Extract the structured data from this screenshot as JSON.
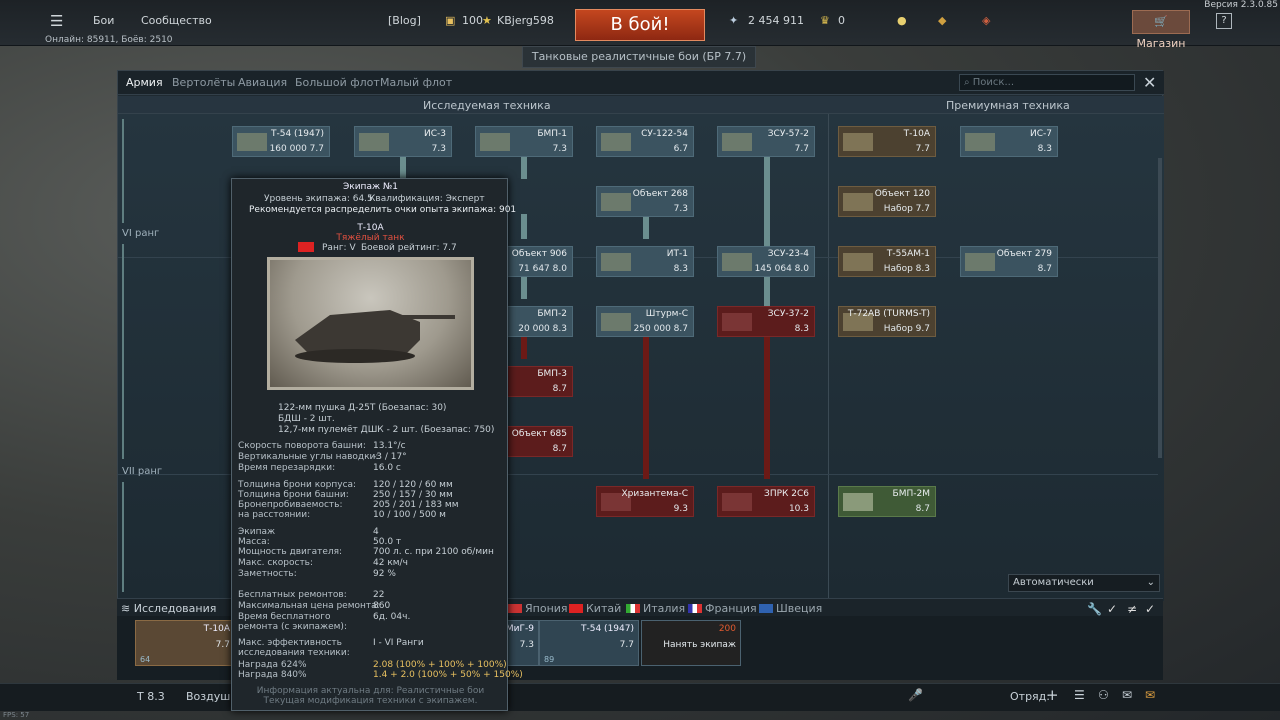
{
  "app": {
    "version": "Версия 2.3.0.85",
    "fps": "FPS: 57"
  },
  "topbar": {
    "menu_items": [
      "Бои",
      "Сообщество"
    ],
    "blog": "[Blog]",
    "level": "100",
    "username": "KBjerg598",
    "battle_button": "В бой!",
    "silver_lions": "2 454 911",
    "golden_eagles": "0",
    "shop": "Магазин",
    "help": "?",
    "online": "Онлайн: 85911, Боёв: 2510"
  },
  "mode_box": "Танковые реалистичные бои (БР 7.7)",
  "tabs": [
    {
      "label": "Армия",
      "active": true
    },
    {
      "label": "Вертолёты",
      "active": false
    },
    {
      "label": "Авиация",
      "active": false
    },
    {
      "label": "Большой флот",
      "active": false
    },
    {
      "label": "Малый флот",
      "active": false
    }
  ],
  "search_placeholder": "Поиск...",
  "section_headers": {
    "research": "Исследуемая техника",
    "premium": "Премиумная техника"
  },
  "ranks": [
    "VI ранг",
    "VII ранг"
  ],
  "tree": {
    "col1": [
      {
        "name": "Т-54 (1947)",
        "value": "160 000",
        "br": "7.7"
      }
    ],
    "col2": [
      {
        "name": "ИС-3",
        "br": "7.3"
      }
    ],
    "col3": [
      {
        "name": "БМП-1",
        "br": "7.3"
      },
      {
        "name": "Объект 906",
        "value": "71 647",
        "br": "8.0"
      },
      {
        "name": "БМП-2",
        "value": "20 000",
        "br": "8.3"
      },
      {
        "name": "БМП-3",
        "br": "8.7"
      },
      {
        "name": "Объект 685",
        "br": "8.7"
      }
    ],
    "col4": [
      {
        "name": "СУ-122-54",
        "br": "6.7"
      },
      {
        "name": "Объект 268",
        "br": "7.3"
      },
      {
        "name": "ИТ-1",
        "br": "8.3"
      },
      {
        "name": "Штурм-С",
        "value": "250 000",
        "br": "8.7"
      },
      {
        "name": "Хризантема-С",
        "br": "9.3"
      }
    ],
    "col5": [
      {
        "name": "ЗСУ-57-2",
        "br": "7.7"
      },
      {
        "name": "ЗСУ-23-4",
        "value": "145 064",
        "br": "8.0"
      },
      {
        "name": "ЗСУ-37-2",
        "br": "8.3"
      },
      {
        "name": "ЗПРК 2С6",
        "br": "10.3"
      }
    ],
    "prem1": [
      {
        "name": "Т-10А",
        "br": "7.7"
      },
      {
        "name": "Объект 120",
        "br": "Набор 7.7"
      },
      {
        "name": "Т-55АМ-1",
        "br": "Набор 8.3"
      },
      {
        "name": "Т-72АВ (TURMS-T)",
        "br": "Набор 9.7"
      },
      {
        "name": "БМП-2М",
        "br": "8.7"
      }
    ],
    "prem2": [
      {
        "name": "ИС-7",
        "br": "8.3"
      },
      {
        "name": "Объект 279",
        "br": "8.7"
      }
    ]
  },
  "auto_select": "Автоматически",
  "research_label": "Исследования",
  "nations": [
    "Япония",
    "Китай",
    "Италия",
    "Франция",
    "Швеция"
  ],
  "slots": [
    {
      "name": "Т-10А",
      "br": "7.7",
      "crew": "64"
    },
    {
      "name": "МиГ-9",
      "br": "7.3",
      "crew": ""
    },
    {
      "name": "Т-54 (1947)",
      "br": "7.7",
      "crew": "89"
    }
  ],
  "hire_crew": {
    "label": "Нанять экипаж",
    "cost": "200"
  },
  "bottombar": {
    "crew_br": "Т 8.3",
    "vehicle_prefix": "Воздушн",
    "squad": "Отряд:"
  },
  "tooltip": {
    "crew": "Экипаж №1",
    "crew_level": "Уровень экипажа: 64.5",
    "qualification": "Квалификация: Эксперт",
    "recommend": "Рекомендуется распределить очки опыта экипажа: 901",
    "vehicle": "Т-10А",
    "class": "Тяжёлый танк",
    "rank": "Ранг: V",
    "battle_rating": "Боевой рейтинг: 7.7",
    "armament": [
      "122-мм пушка Д-25Т (Боезапас: 30)",
      "БДШ - 2 шт.",
      "12,7-мм пулемёт ДШК - 2 шт. (Боезапас: 750)"
    ],
    "stats": [
      {
        "label": "Скорость поворота башни:",
        "value": "13.1°/с"
      },
      {
        "label": "Вертикальные углы наводки:",
        "value": "-3 / 17°"
      },
      {
        "label": "Время перезарядки:",
        "value": "16.0 с"
      },
      {
        "label": "Толщина брони корпуса:",
        "value": "120 / 120 / 60 мм"
      },
      {
        "label": "Толщина брони башни:",
        "value": "250 / 157 / 30 мм"
      },
      {
        "label": "Бронепробиваемость:",
        "value": "205 / 201 / 183 мм"
      },
      {
        "label": "на расстоянии:",
        "value": "10 / 100 / 500 м"
      },
      {
        "label": "Экипаж",
        "value": "4"
      },
      {
        "label": "Масса:",
        "value": "50.0 т"
      },
      {
        "label": "Мощность двигателя:",
        "value": "700 л. с. при 2100 об/мин"
      },
      {
        "label": "Макс. скорость:",
        "value": "42 км/ч"
      },
      {
        "label": "Заметность:",
        "value": "92 %"
      },
      {
        "label": "Бесплатных ремонтов:",
        "value": "22"
      },
      {
        "label": "Максимальная цена ремонта:",
        "value": "860"
      },
      {
        "label": "Время бесплатного ремонта (с экипажем):",
        "value": "6д. 04ч."
      },
      {
        "label": "Макс. эффективность исследования техники:",
        "value": "I - VI Ранги"
      },
      {
        "label": "Награда 624%",
        "value": "2.08 (100% + 100% + 100%)"
      },
      {
        "label": "Награда 840%",
        "value": "1.4 + 2.0 (100% + 50% + 150%)"
      }
    ],
    "footer1": "Информация актуальна для: Реалистичные бои",
    "footer2": "Текущая модификация техники с экипажем."
  },
  "colors": {
    "researched": "#3b5360",
    "locked": "#5c1c1c",
    "premium": "#4c4130",
    "battle": "#b23a1a"
  }
}
